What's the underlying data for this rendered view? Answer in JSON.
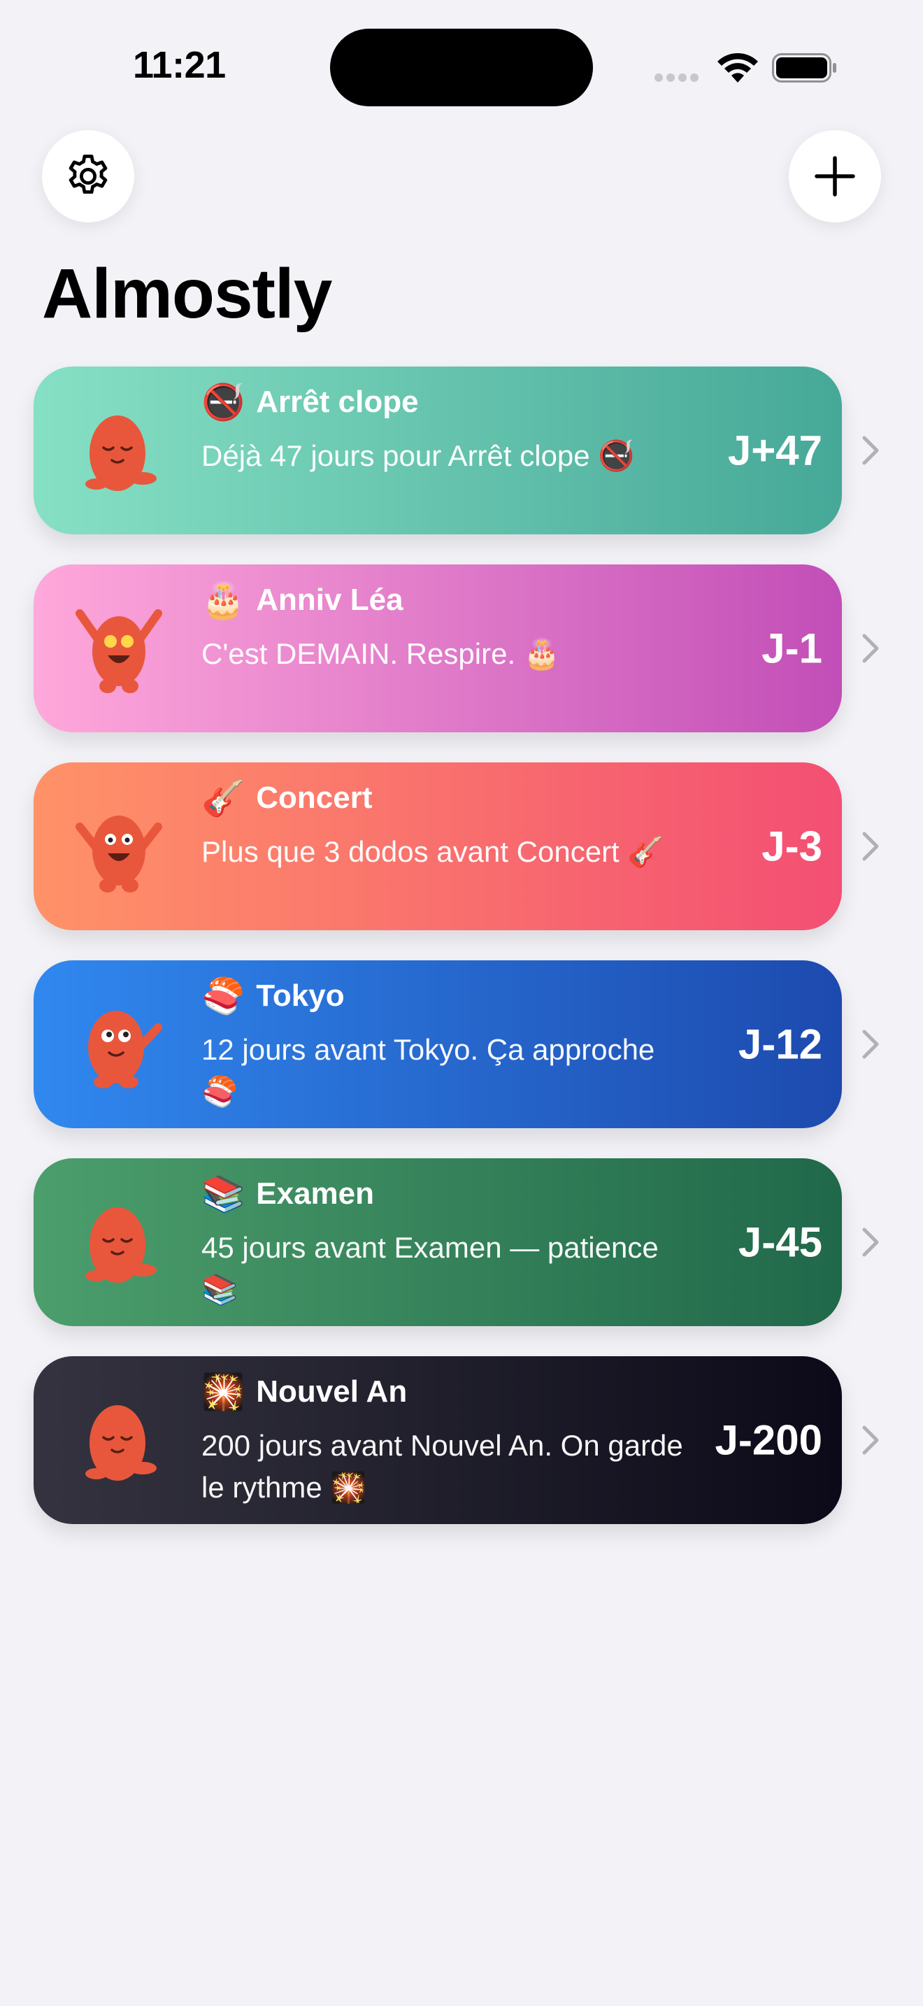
{
  "status_bar": {
    "time": "11:21"
  },
  "header": {
    "title": "Almostly",
    "settings_icon": "gear-icon",
    "add_icon": "plus-icon"
  },
  "events": [
    {
      "emoji": "🚭",
      "name": "Arrêt clope",
      "subtitle": "Déjà 47 jours pour Arrêt clope 🚭",
      "count": "J+47",
      "mascot": "calm-mascot",
      "gradient": [
        "#86e0c4",
        "#46a898"
      ]
    },
    {
      "emoji": "🎂",
      "name": "Anniv Léa",
      "subtitle": "C'est DEMAIN. Respire. 🎂",
      "count": "J-1",
      "mascot": "excited-mascot",
      "gradient": [
        "#ffa8db",
        "#c24eb7"
      ]
    },
    {
      "emoji": "🎸",
      "name": "Concert",
      "subtitle": "Plus que 3 dodos avant Concert 🎸",
      "count": "J-3",
      "mascot": "happy-mascot",
      "gradient": [
        "#ff9268",
        "#f34f73"
      ]
    },
    {
      "emoji": "🍣",
      "name": "Tokyo",
      "subtitle": "12 jours avant Tokyo. Ça approche 🍣",
      "count": "J-12",
      "mascot": "waving-mascot",
      "gradient": [
        "#3088ef",
        "#1d4aae"
      ]
    },
    {
      "emoji": "📚",
      "name": "Examen",
      "subtitle": "45 jours avant Examen — patience 📚",
      "count": "J-45",
      "mascot": "calm-mascot",
      "gradient": [
        "#4c9e6c",
        "#20684a"
      ]
    },
    {
      "emoji": "🎇",
      "name": "Nouvel An",
      "subtitle": "200 jours avant Nouvel An. On garde le rythme 🎇",
      "count": "J-200",
      "mascot": "calm-mascot",
      "gradient": [
        "#34333f",
        "#0c0a18"
      ]
    }
  ],
  "colors": {
    "background": "#f2f2f7",
    "mascot": "#e8573c"
  }
}
